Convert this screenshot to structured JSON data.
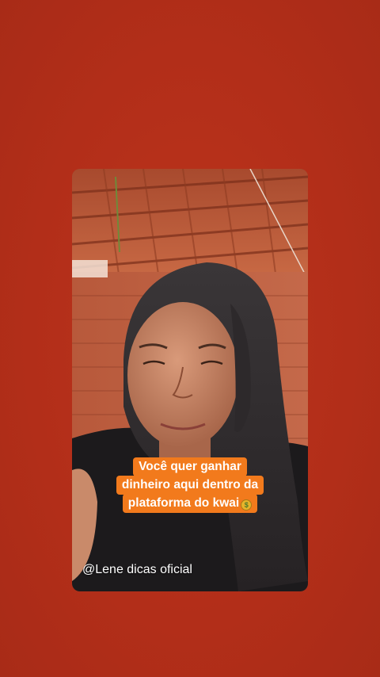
{
  "story": {
    "background_color": "#b6301a",
    "caption": {
      "line1": "Você quer ganhar",
      "line2": "dinheiro aqui dentro da",
      "line3": "plataforma do kwai",
      "line3_icon": "money-bag-icon",
      "highlight_color": "#f27a1c"
    },
    "watermark": "@Lene dicas oficial"
  }
}
